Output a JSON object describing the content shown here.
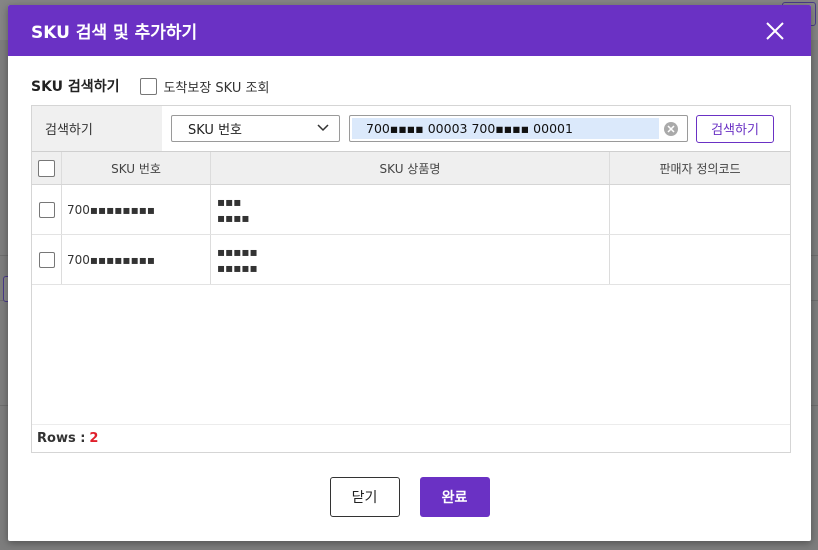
{
  "modal": {
    "title": "SKU 검색 및 추가하기"
  },
  "section": {
    "title": "SKU 검색하기",
    "checkbox_label": "도착보장 SKU 조회"
  },
  "search": {
    "label": "검색하기",
    "select_value": "SKU 번호",
    "input_value": "700▪▪▪▪ 00003 700▪▪▪▪ 00001",
    "button_label": "검색하기"
  },
  "table": {
    "columns": [
      "SKU 번호",
      "SKU 상품명",
      "판매자 정의코드"
    ],
    "rows": [
      {
        "sku": "700▪▪▪▪▪▪▪▪",
        "name_line1": "▪▪▪",
        "name_line2": "▪▪▪▪",
        "seller_code": ""
      },
      {
        "sku": "700▪▪▪▪▪▪▪▪",
        "name_line1": "▪▪▪▪▪",
        "name_line2": "▪▪▪▪▪",
        "seller_code": ""
      }
    ],
    "rows_label": "Rows :",
    "rows_count": "2"
  },
  "footer": {
    "close_label": "닫기",
    "done_label": "완료"
  },
  "colors": {
    "accent": "#6a31c4",
    "count_red": "#e01f2b"
  }
}
